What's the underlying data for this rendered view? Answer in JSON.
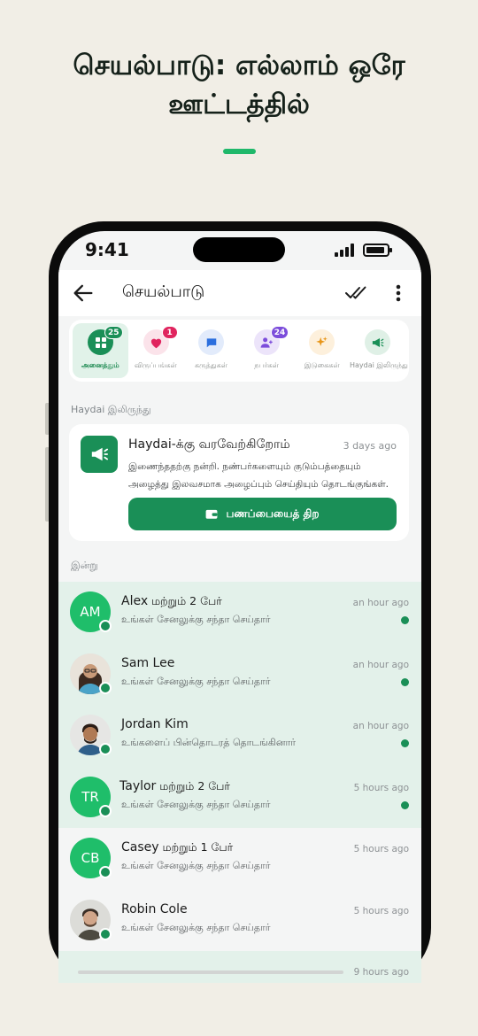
{
  "headline": {
    "line1": "செயல்பாடு: எல்லாம் ஒரே",
    "line2": "ஊட்டத்தில்"
  },
  "status_bar": {
    "time": "9:41"
  },
  "appbar": {
    "title": "செயல்பாடு",
    "back_icon": "arrow-left-icon",
    "mark_read_icon": "double-check-icon",
    "more_icon": "more-vertical-icon"
  },
  "filters": [
    {
      "label": "அனைத்தும்",
      "badge": "25",
      "icon": "grid-icon",
      "active": true
    },
    {
      "label": "விருப்பங்கள்",
      "badge": "1",
      "icon": "heart-icon",
      "active": false
    },
    {
      "label": "கருத்துகள்",
      "badge": "",
      "icon": "comment-icon",
      "active": false
    },
    {
      "label": "நபர்கள்",
      "badge": "24",
      "icon": "person-add-icon",
      "active": false
    },
    {
      "label": "இடுகைகள்",
      "badge": "",
      "icon": "sparkle-icon",
      "active": false
    },
    {
      "label": "Haydai இலிருந்து",
      "badge": "",
      "icon": "megaphone-icon",
      "active": false
    }
  ],
  "sections": {
    "from_haydai": "Haydai இலிருந்து",
    "today": "இன்று"
  },
  "promo": {
    "title": "Haydai-க்கு வரவேற்கிறோம்",
    "time": "3 days ago",
    "body": "இணைந்ததற்கு நன்றி. நண்பர்களையும் குடும்பத்தையும் அழைத்து இலவசமாக அழைப்பும் செய்தியும் தொடங்குங்கள்.",
    "button_label": "பணப்பையைத் திற",
    "button_icon": "wallet-icon"
  },
  "notifications": [
    {
      "name": "Alex",
      "rest": " மற்றும் 2 பேர்",
      "subtitle": "உங்கள் சேனலுக்கு சந்தா செய்தார்",
      "time": "an hour ago",
      "avatar": "AM",
      "unread": true
    },
    {
      "name": "Sam Lee",
      "rest": "",
      "subtitle": "உங்கள் சேனலுக்கு சந்தா செய்தார்",
      "time": "an hour ago",
      "avatar": "photo-sam",
      "unread": true
    },
    {
      "name": "Jordan Kim",
      "rest": "",
      "subtitle": "உங்களைப் பின்தொடரத் தொடங்கினார்",
      "time": "an hour ago",
      "avatar": "photo-jordan",
      "unread": true
    },
    {
      "name": "Taylor",
      "rest": " மற்றும் 2 பேர்",
      "subtitle": "உங்கள் சேனலுக்கு சந்தா செய்தார்",
      "time": "5 hours ago",
      "avatar": "TR",
      "unread": true
    },
    {
      "name": "Casey",
      "rest": " மற்றும் 1 பேர்",
      "subtitle": "உங்கள் சேனலுக்கு சந்தா செய்தார்",
      "time": "5 hours ago",
      "avatar": "CB",
      "unread": false
    },
    {
      "name": "Robin Cole",
      "rest": "",
      "subtitle": "உங்கள் சேனலுக்கு சந்தா செய்தார்",
      "time": "5 hours ago",
      "avatar": "photo-robin",
      "unread": false
    },
    {
      "name": "",
      "rest": "",
      "subtitle": "",
      "time": "9 hours ago",
      "avatar": "",
      "unread": true
    }
  ],
  "colors": {
    "brand_green": "#1a8f57",
    "avatar_green": "#1fbe6a",
    "unread_bg": "#e3f1ea",
    "page_bg": "#f1eee6"
  }
}
